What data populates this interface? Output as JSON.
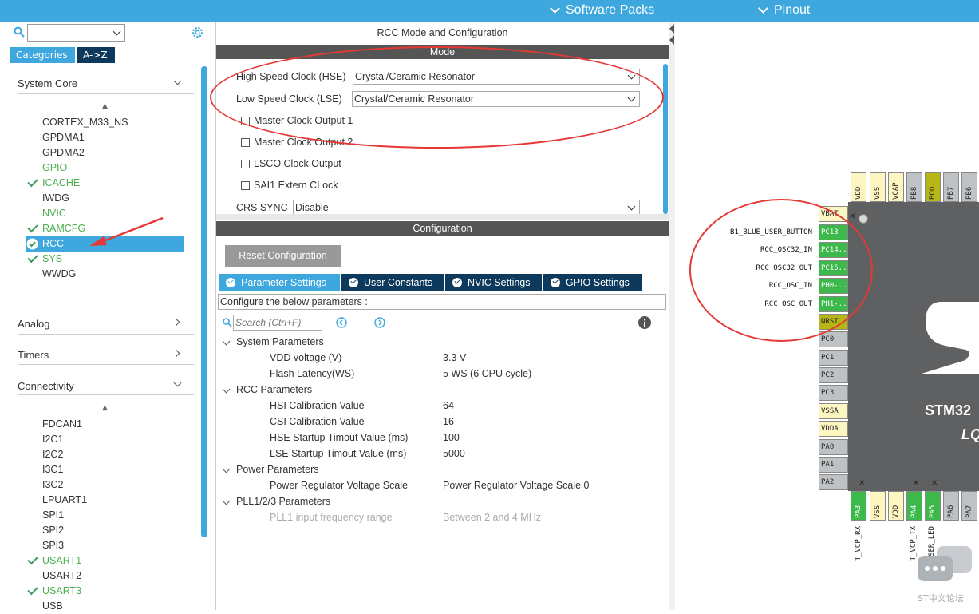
{
  "topbar": {
    "software_packs": "Software Packs",
    "pinout": "Pinout"
  },
  "left": {
    "tabs": {
      "categories": "Categories",
      "az": "A->Z"
    },
    "sections": {
      "system_core": "System Core",
      "analog": "Analog",
      "timers": "Timers",
      "connectivity": "Connectivity"
    },
    "system_core_items": [
      "CORTEX_M33_NS",
      "GPDMA1",
      "GPDMA2",
      "GPIO",
      "ICACHE",
      "IWDG",
      "NVIC",
      "RAMCFG",
      "RCC",
      "SYS",
      "WWDG"
    ],
    "connectivity_items": [
      "FDCAN1",
      "I2C1",
      "I2C2",
      "I3C1",
      "I3C2",
      "LPUART1",
      "SPI1",
      "SPI2",
      "SPI3",
      "USART1",
      "USART2",
      "USART3",
      "USB"
    ]
  },
  "mid": {
    "title": "RCC Mode and Configuration",
    "mode_header": "Mode",
    "hse_label": "High Speed Clock (HSE)",
    "hse_value": "Crystal/Ceramic Resonator",
    "lse_label": "Low Speed Clock (LSE)",
    "lse_value": "Crystal/Ceramic Resonator",
    "mco1": "Master Clock Output 1",
    "mco2": "Master Clock Output 2",
    "lsco": "LSCO Clock Output",
    "sai1": "SAI1 Extern CLock",
    "crs_label": "CRS SYNC",
    "crs_value": "Disable",
    "config_header": "Configuration",
    "reset_button": "Reset Configuration",
    "tabs": [
      "Parameter Settings",
      "User Constants",
      "NVIC Settings",
      "GPIO Settings"
    ],
    "configure_text": "Configure the below parameters :",
    "search_placeholder": "Search (Ctrl+F)",
    "params": {
      "system": "System Parameters",
      "vdd_label": "VDD voltage (V)",
      "vdd_value": "3.3 V",
      "flash_label": "Flash Latency(WS)",
      "flash_value": "5 WS (6 CPU cycle)",
      "rcc": "RCC Parameters",
      "hsi_label": "HSI Calibration Value",
      "hsi_value": "64",
      "csi_label": "CSI Calibration Value",
      "csi_value": "16",
      "hse_startup_label": "HSE Startup Timout Value (ms)",
      "hse_startup_value": "100",
      "lse_startup_label": "LSE Startup Timout Value (ms)",
      "lse_startup_value": "5000",
      "power": "Power Parameters",
      "prvs_label": "Power Regulator Voltage Scale",
      "prvs_value": "Power Regulator Voltage Scale 0",
      "pll": "PLL1/2/3 Parameters",
      "pll_label": "PLL1 input frequency range",
      "pll_value": "Between 2 and 4 MHz"
    }
  },
  "right": {
    "top_pins": [
      "VDD",
      "VSS",
      "VCAP",
      "PB8",
      "BOO..",
      "PB7",
      "PB6"
    ],
    "left_pins": [
      "VBAT",
      "PC13",
      "PC14..",
      "PC15..",
      "PH0-..",
      "PH1-..",
      "NRST",
      "PC0",
      "PC1",
      "PC2",
      "PC3",
      "VSSA",
      "VDDA",
      "PA0",
      "PA1",
      "PA2"
    ],
    "bottom_pins": [
      "PA3",
      "VSS",
      "VDD",
      "PA4",
      "PA5",
      "PA6",
      "PA7"
    ],
    "signals": [
      "B1_BLUE_USER_BUTTON",
      "RCC_OSC32_IN",
      "RCC_OSC32_OUT",
      "RCC_OSC_IN",
      "RCC_OSC_OUT"
    ],
    "bottom_signals": [
      "T_VCP_RX",
      "T_VCP_TX",
      "USER_LED"
    ],
    "chip_name": "STM32",
    "chip_sub": "LQ",
    "watermark": "ST中文论坛"
  },
  "colors": {
    "accent": "#3da7de",
    "dark_tab": "#0d3a5c",
    "pin_green": "#3cb94a",
    "annotation_red": "#e53935"
  }
}
